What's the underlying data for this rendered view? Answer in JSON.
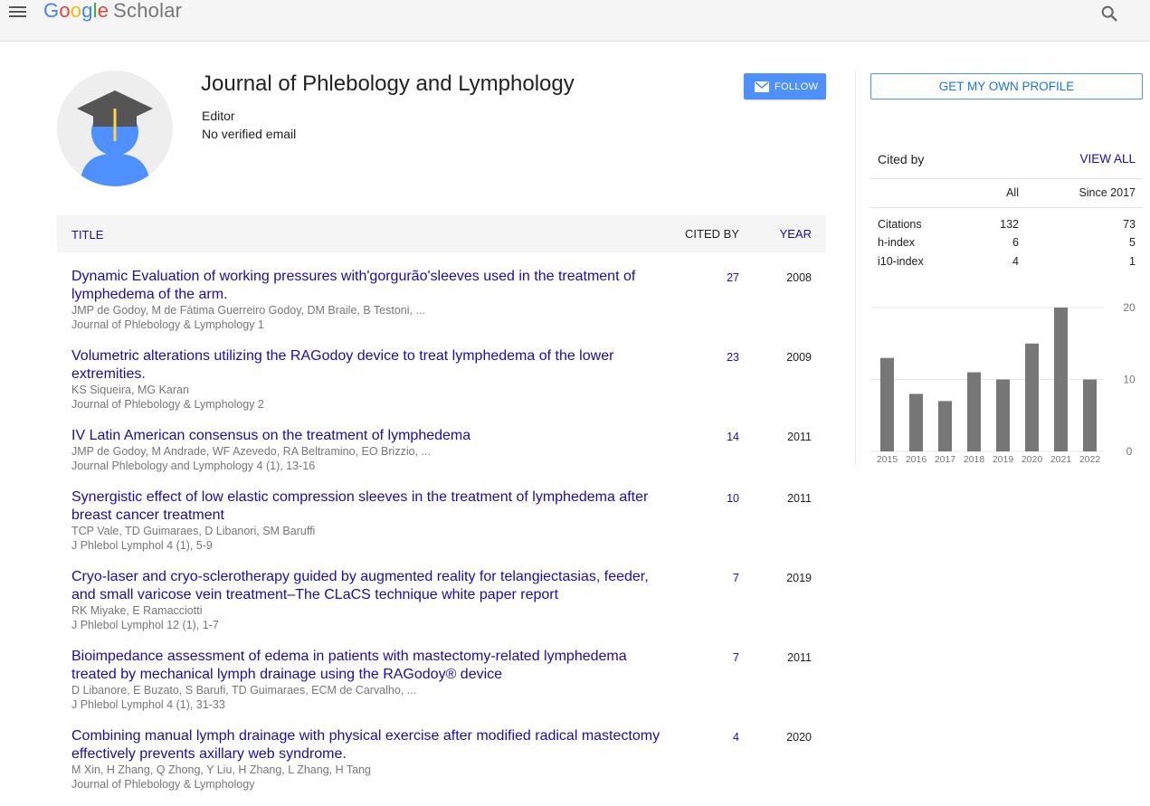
{
  "header": {
    "logo_google": [
      "G",
      "o",
      "o",
      "g",
      "l",
      "e"
    ],
    "logo_scholar": "Scholar"
  },
  "profile": {
    "name": "Journal of Phlebology and Lymphology",
    "affiliation": "Editor",
    "email": "No verified email",
    "follow_label": "FOLLOW"
  },
  "table": {
    "col_title": "TITLE",
    "col_cited": "CITED BY",
    "col_year": "YEAR",
    "rows": [
      {
        "title": "Dynamic Evaluation of working pressures with'gorgurão'sleeves used in the treatment of lymphedema of the arm.",
        "authors": "JMP de Godoy, M de Fátima Guerreiro Godoy, DM Braile, B Testoni, ...",
        "venue": "Journal of Phlebology & Lymphology 1",
        "cited": "27",
        "year": "2008"
      },
      {
        "title": "Volumetric alterations utilizing the RAGodoy device to treat lymphedema of the lower extremities.",
        "authors": "KS Siqueira, MG Karan",
        "venue": "Journal of Phlebology & Lymphology 2",
        "cited": "23",
        "year": "2009"
      },
      {
        "title": "IV Latin American consensus on the treatment of lymphedema",
        "authors": "JMP de Godoy, M Andrade, WF Azevedo, RA Beltramino, EO Brizzio, ...",
        "venue": "Journal Phlebology and Lymphology 4 (1), 13-16",
        "cited": "14",
        "year": "2011"
      },
      {
        "title": "Synergistic effect of low elastic compression sleeves in the treatment of lymphedema after breast cancer treatment",
        "authors": "TCP Vale, TD Guimaraes, D Libanori, SM Baruffi",
        "venue": "J Phlebol Lymphol 4 (1), 5-9",
        "cited": "10",
        "year": "2011"
      },
      {
        "title": "Cryo-laser and cryo-sclerotherapy guided by augmented reality for telangiectasias, feeder, and small varicose vein treatment–The CLaCS technique white paper report",
        "authors": "RK Miyake, E Ramacciotti",
        "venue": "J Phlebol Lymphol 12 (1), 1-7",
        "cited": "7",
        "year": "2019"
      },
      {
        "title": "Bioimpedance assessment of edema in patients with mastectomy-related lymphedema treated by mechanical lymph drainage using the RAGodoy® device",
        "authors": "D Libanore, E Buzato, S Barufi, TD Guimaraes, ECM de Carvalho, ...",
        "venue": "J Phlebol Lymphol 4 (1), 31-33",
        "cited": "7",
        "year": "2011"
      },
      {
        "title": "Combining manual lymph drainage with physical exercise after modified radical mastectomy effectively prevents axillary web syndrome.",
        "authors": "M Xin, H Zhang, Q Zhong, Y Liu, H Zhang, L Zhang, H Tang",
        "venue": "Journal of Phlebology & Lymphology",
        "cited": "4",
        "year": "2020"
      }
    ]
  },
  "sidebar": {
    "profile_button": "GET MY OWN PROFILE",
    "cited_by": "Cited by",
    "view_all": "VIEW ALL",
    "col_all": "All",
    "col_since": "Since 2017",
    "metrics": [
      {
        "label": "Citations",
        "all": "132",
        "since": "73"
      },
      {
        "label": "h-index",
        "all": "6",
        "since": "5"
      },
      {
        "label": "i10-index",
        "all": "4",
        "since": "1"
      }
    ]
  },
  "chart_data": {
    "type": "bar",
    "categories": [
      "2015",
      "2016",
      "2017",
      "2018",
      "2019",
      "2020",
      "2021",
      "2022"
    ],
    "values": [
      13,
      8,
      7,
      11,
      10,
      15,
      20,
      10
    ],
    "ylim": [
      0,
      20
    ],
    "yticks": [
      "0",
      "10",
      "20"
    ],
    "bar_color": "#777777",
    "grid": true
  }
}
